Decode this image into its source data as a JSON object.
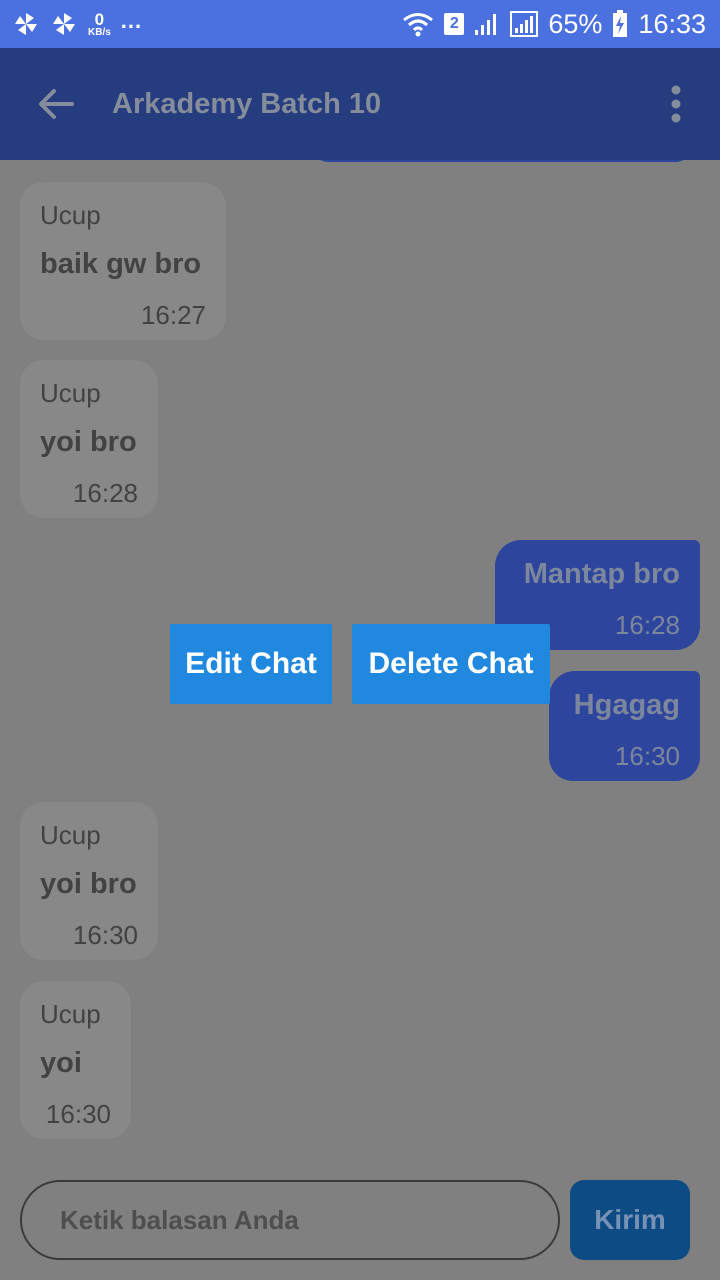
{
  "status_bar": {
    "net_speed_value": "0",
    "net_speed_unit": "KB/s",
    "more_dots": "...",
    "sim_badge": "2",
    "battery_percent": "65%",
    "time": "16:33",
    "icons": [
      "pinwheel-icon",
      "pinwheel-icon",
      "wifi-icon",
      "signal-icon",
      "signal-icon",
      "battery-charging-icon"
    ]
  },
  "app_bar": {
    "title": "Arkademy Batch 10",
    "back_icon": "arrow-left-icon",
    "menu_icon": "more-vert-icon"
  },
  "messages": [
    {
      "direction": "incoming",
      "sender": "Ucup",
      "text": "baik gw bro",
      "time": "16:27"
    },
    {
      "direction": "incoming",
      "sender": "Ucup",
      "text": "yoi bro",
      "time": "16:28"
    },
    {
      "direction": "outgoing",
      "text": "Mantap bro",
      "time": "16:28"
    },
    {
      "direction": "outgoing",
      "text": "Hgagag",
      "time": "16:30"
    },
    {
      "direction": "incoming",
      "sender": "Ucup",
      "text": "yoi bro",
      "time": "16:30"
    },
    {
      "direction": "incoming",
      "sender": "Ucup",
      "text": "yoi",
      "time": "16:30"
    }
  ],
  "context_menu": {
    "edit_label": "Edit Chat",
    "delete_label": "Delete Chat"
  },
  "composer": {
    "placeholder": "Ketik balasan Anda",
    "send_label": "Kirim"
  },
  "colors": {
    "status_bar": "#4a71df",
    "app_bar": "#253d7f",
    "overlay_background": "#808080",
    "incoming_bubble": "#888888",
    "outgoing_bubble": "#2d459c",
    "action_button": "#2188e0",
    "send_button": "#0c4b84"
  }
}
